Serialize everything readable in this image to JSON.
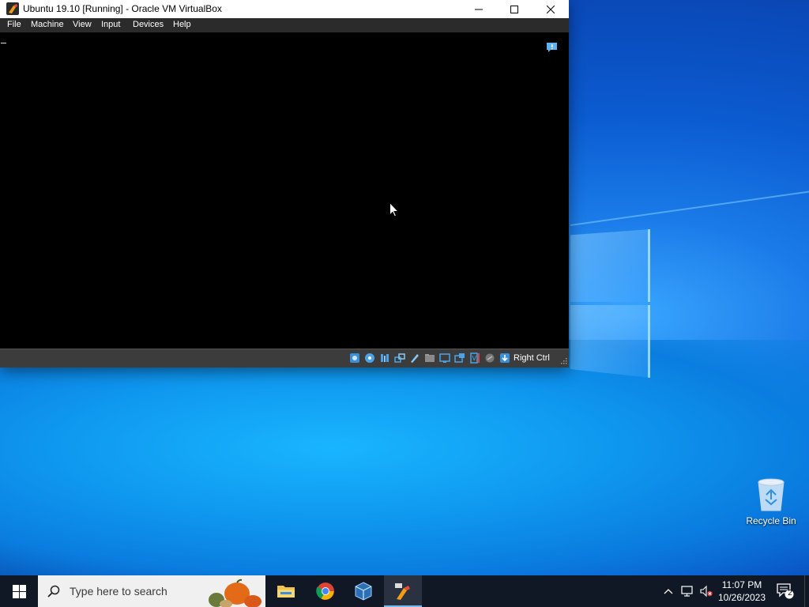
{
  "window": {
    "title": "Ubuntu 19.10 [Running] - Oracle VM VirtualBox",
    "menu": [
      "File",
      "Machine",
      "View",
      "Input",
      "Devices",
      "Help"
    ],
    "status_icons": [
      "hard-disk-icon",
      "optical-disc-icon",
      "audio-icon",
      "network-icon",
      "usb-icon",
      "shared-folders-icon",
      "display-icon",
      "video-capture-icon",
      "cpu-icon",
      "mouse-integration-icon",
      "keyboard-icon"
    ],
    "host_key": "Right Ctrl"
  },
  "desktop": {
    "recycle_bin_label": "Recycle Bin"
  },
  "taskbar": {
    "search_placeholder": "Type here to search",
    "pinned_apps": [
      "file-explorer-icon",
      "chrome-icon",
      "virtualbox-icon",
      "virtualbox-vm-icon"
    ],
    "clock_time": "11:07 PM",
    "clock_date": "10/26/2023",
    "notification_count": "2"
  },
  "colors": {
    "taskbar": "#101826",
    "accent": "#76b9ed",
    "vm_screen": "#000000"
  }
}
